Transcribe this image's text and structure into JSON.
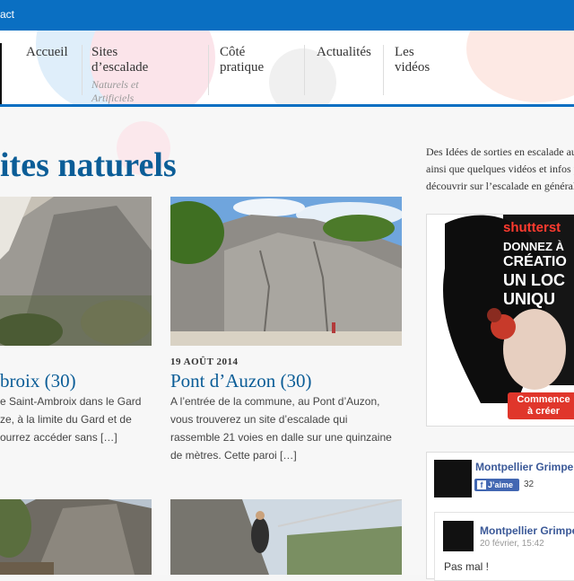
{
  "topbar": {
    "contact_label": "act"
  },
  "nav": {
    "items": [
      {
        "label": "Accueil"
      },
      {
        "label": "Sites d’escalade",
        "sub": "Naturels et Artificiels"
      },
      {
        "label": "Côté pratique"
      },
      {
        "label": "Actualités"
      },
      {
        "label": "Les vidéos"
      }
    ]
  },
  "page": {
    "title": "ites naturels"
  },
  "posts": [
    {
      "title": "broix (30)",
      "excerpt": [
        "e Saint-Ambroix dans le Gard",
        "ze, à la limite du Gard et de",
        "ourrez accéder sans […]"
      ]
    },
    {
      "date": "19 AOÛT 2014",
      "title": "Pont d’Auzon (30)",
      "excerpt": [
        "A l’entrée de la commune, au Pont d’Auzon,",
        "vous trouverez un site d’escalade qui",
        "rassemble 21 voies en dalle sur une quinzaine",
        "de mètres. Cette paroi […]"
      ]
    }
  ],
  "sidebar": {
    "intro": [
      "Des Idées de sorties en escalade aut",
      "ainsi que quelques vidéos et infos p",
      "découvrir sur l’escalade en général."
    ],
    "ad": {
      "brand": "shutterst",
      "lines": [
        "DONNEZ À",
        "CRÉATIO",
        "UN LOC",
        "UNIQU"
      ],
      "cta": [
        "Commence",
        "à créer"
      ]
    },
    "facebook": {
      "page_name": "Montpellier Grimpe",
      "like_label": "J’aime",
      "like_count": "32",
      "post": {
        "author": "Montpellier Grimpe",
        "date": "20 février, 15:42",
        "text": "Pas mal !"
      }
    }
  },
  "colors": {
    "brand_blue": "#0a6fc2",
    "title_blue": "#0b5d97",
    "fb_blue": "#4267b2"
  }
}
